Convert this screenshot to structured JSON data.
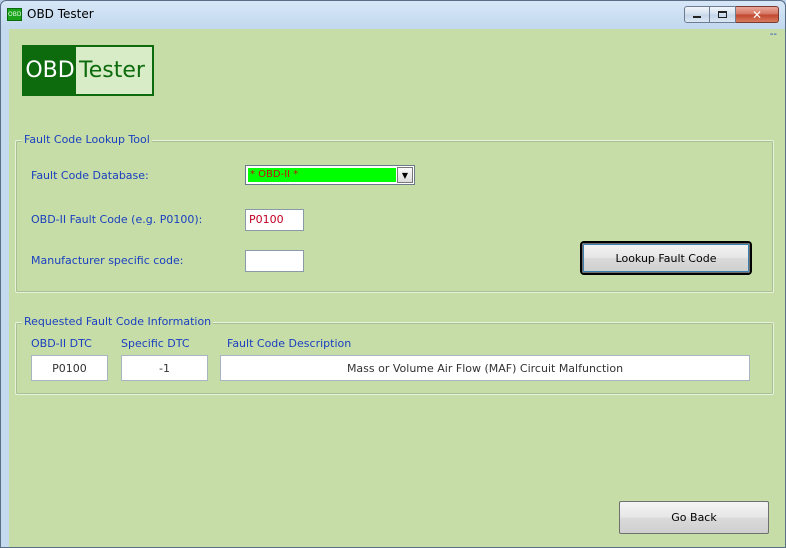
{
  "window": {
    "title": "OBD Tester",
    "app_icon_text": "OBD",
    "corner_text": "--"
  },
  "logo": {
    "part1": "OBD",
    "part2": "Tester"
  },
  "lookup": {
    "group_title": "Fault Code Lookup Tool",
    "db_label": "Fault Code Database:",
    "db_selected": "* OBD-II *",
    "obd_label": "OBD-II Fault Code (e.g. P0100):",
    "obd_value": "P0100",
    "mfr_label": "Manufacturer specific code:",
    "mfr_value": "",
    "lookup_button": "Lookup Fault Code"
  },
  "info": {
    "group_title": "Requested Fault Code Information",
    "col_obd": "OBD-II DTC",
    "col_specific": "Specific DTC",
    "col_desc": "Fault Code Description",
    "val_obd": "P0100",
    "val_specific": "-1",
    "val_desc": "Mass or Volume Air Flow (MAF) Circuit Malfunction"
  },
  "footer": {
    "go_back": "Go Back"
  }
}
